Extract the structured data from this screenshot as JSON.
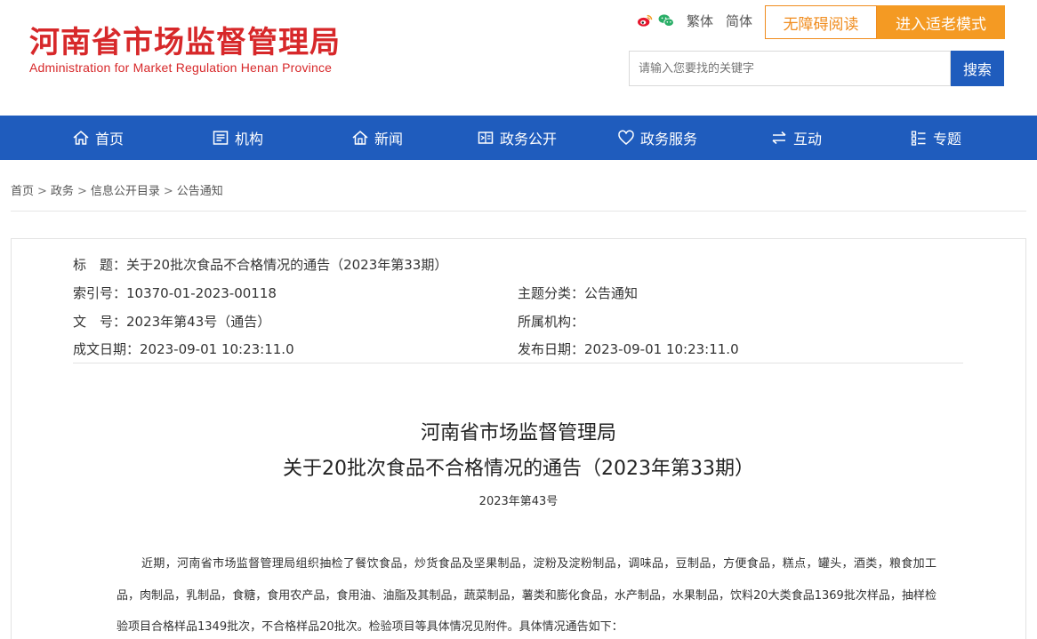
{
  "header": {
    "logo_cn": "河南省市场监督管理局",
    "logo_en": "Administration for Market Regulation Henan Province",
    "traditional": "繁体",
    "simplified": "简体",
    "accessible_label": "无障碍阅读",
    "elder_label": "进入适老模式",
    "search_placeholder": "请输入您要找的关键字",
    "search_button": "搜索"
  },
  "nav": {
    "items": [
      {
        "label": "首页",
        "icon": "home-icon"
      },
      {
        "label": "机构",
        "icon": "org-icon"
      },
      {
        "label": "新闻",
        "icon": "news-icon"
      },
      {
        "label": "政务公开",
        "icon": "open-icon"
      },
      {
        "label": "政务服务",
        "icon": "heart-icon"
      },
      {
        "label": "互动",
        "icon": "exchange-icon"
      },
      {
        "label": "专题",
        "icon": "topic-icon"
      }
    ]
  },
  "breadcrumb": {
    "items": [
      "首页",
      "政务",
      "信息公开目录",
      "公告通知"
    ],
    "separator": ">"
  },
  "meta": {
    "title": "标　题：关于20批次食品不合格情况的通告（2023年第33期）",
    "index": "索引号：10370-01-2023-00118",
    "category": "主题分类：公告通知",
    "doc_no": "文　号：2023年第43号（通告）",
    "org": "所属机构：",
    "created": "成文日期：2023-09-01 10:23:11.0",
    "published": "发布日期：2023-09-01 10:23:11.0"
  },
  "article": {
    "issuer": "河南省市场监督管理局",
    "title": "关于20批次食品不合格情况的通告（2023年第33期）",
    "number": "2023年第43号",
    "paragraph": "近期，河南省市场监督管理局组织抽检了餐饮食品，炒货食品及坚果制品，淀粉及淀粉制品，调味品，豆制品，方便食品，糕点，罐头，酒类，粮食加工品，肉制品，乳制品，食糖，食用农产品，食用油、油脂及其制品，蔬菜制品，薯类和膨化食品，水产制品，水果制品，饮料20大类食品1369批次样品，抽样检验项目合格样品1349批次，不合格样品20批次。检验项目等具体情况见附件。具体情况通告如下："
  },
  "colors": {
    "brand_red": "#d7282a",
    "nav_blue": "#1f5cbd",
    "accent_orange": "#f49a23"
  }
}
